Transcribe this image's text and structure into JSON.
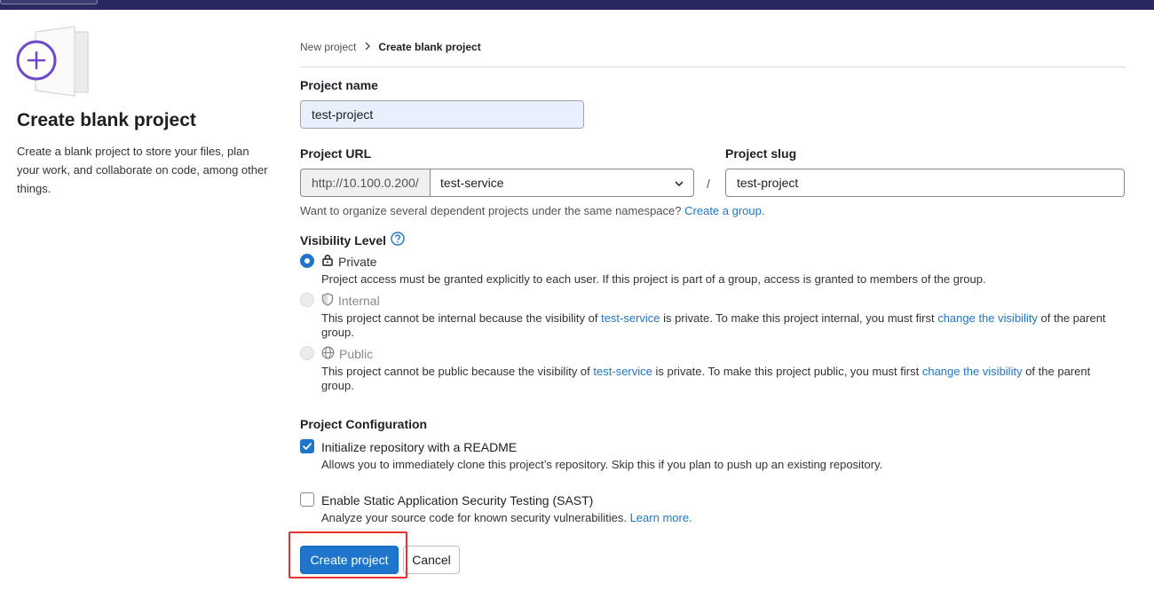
{
  "colors": {
    "accent": "#1f75cb",
    "topbar": "#292961",
    "illustration": "#6e49cb",
    "highlight": "#e8302d"
  },
  "sidebar": {
    "title": "Create blank project",
    "description": "Create a blank project to store your files, plan your work, and collaborate on code, among other things."
  },
  "breadcrumb": {
    "parent": "New project",
    "current": "Create blank project"
  },
  "project_name": {
    "label": "Project name",
    "value": "test-project"
  },
  "project_url": {
    "label": "Project URL",
    "prefix": "http://10.100.0.200/",
    "namespace": "test-service",
    "separator": "/"
  },
  "project_slug": {
    "label": "Project slug",
    "value": "test-project"
  },
  "namespace_help": {
    "text": "Want to organize several dependent projects under the same namespace?",
    "link": "Create a group."
  },
  "visibility": {
    "label": "Visibility Level",
    "help_icon": "question-circle-icon",
    "options": [
      {
        "name": "Private",
        "icon": "lock-icon",
        "selected": true,
        "disabled": false,
        "desc": "Project access must be granted explicitly to each user. If this project is part of a group, access is granted to members of the group."
      },
      {
        "name": "Internal",
        "icon": "shield-icon",
        "selected": false,
        "disabled": true,
        "desc_1": "This project cannot be internal because the visibility of",
        "group_link": "test-service",
        "desc_2": "is private. To make this project internal, you must first",
        "change_link": "change the visibility",
        "desc_3": "of the parent group."
      },
      {
        "name": "Public",
        "icon": "globe-icon",
        "selected": false,
        "disabled": true,
        "desc_1": "This project cannot be public because the visibility of",
        "group_link": "test-service",
        "desc_2": "is private. To make this project public, you must first",
        "change_link": "change the visibility",
        "desc_3": "of the parent group."
      }
    ]
  },
  "configuration": {
    "label": "Project Configuration",
    "readme": {
      "label": "Initialize repository with a README",
      "checked": true,
      "help": "Allows you to immediately clone this project’s repository. Skip this if you plan to push up an existing repository."
    },
    "sast": {
      "label": "Enable Static Application Security Testing (SAST)",
      "checked": false,
      "help": "Analyze your source code for known security vulnerabilities.",
      "link": "Learn more."
    }
  },
  "actions": {
    "create": "Create project",
    "cancel": "Cancel"
  }
}
